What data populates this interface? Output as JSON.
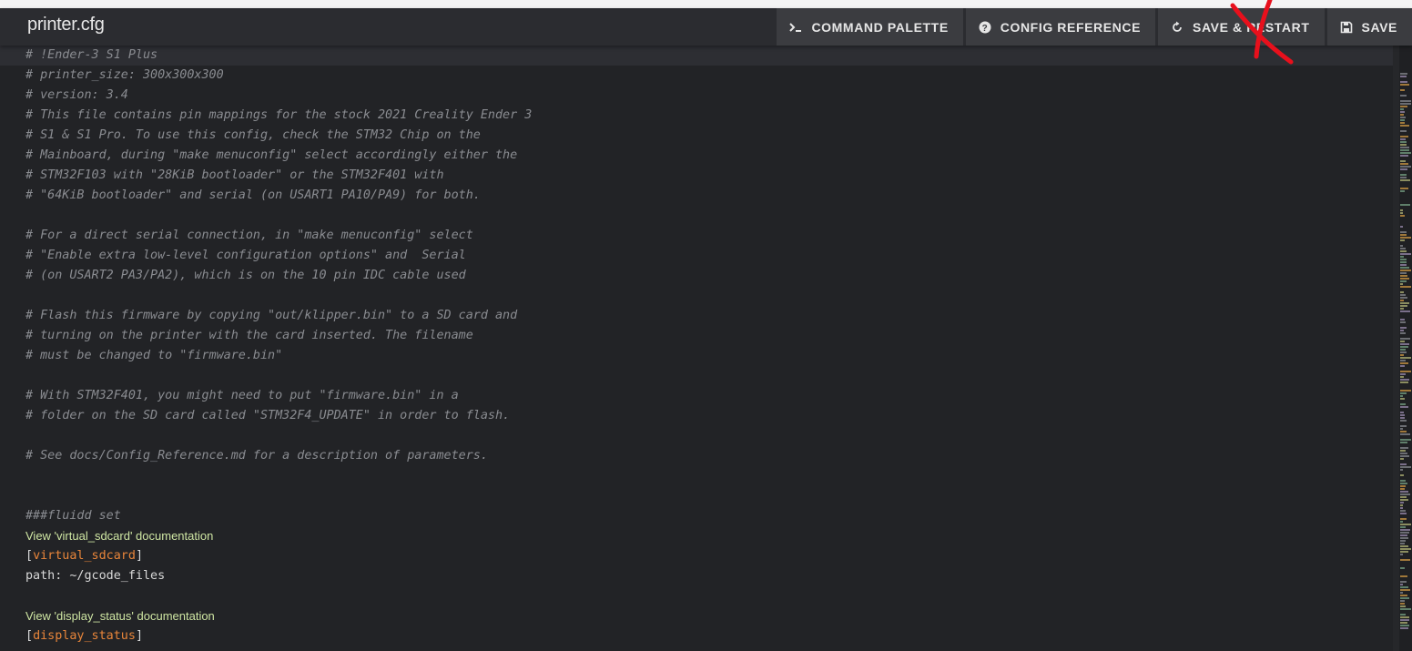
{
  "header": {
    "title": "printer.cfg",
    "buttons": [
      {
        "label": "COMMAND PALETTE",
        "icon": "terminal-icon"
      },
      {
        "label": "CONFIG REFERENCE",
        "icon": "help-circle-icon"
      },
      {
        "label": "SAVE & RESTART",
        "icon": "restart-icon"
      },
      {
        "label": "SAVE",
        "icon": "floppy-icon"
      }
    ]
  },
  "editor": {
    "lines": [
      {
        "type": "comment",
        "text": "# !Ender-3 S1 Plus"
      },
      {
        "type": "comment",
        "text": "# printer_size: 300x300x300"
      },
      {
        "type": "comment",
        "text": "# version: 3.4"
      },
      {
        "type": "comment",
        "text": "# This file contains pin mappings for the stock 2021 Creality Ender 3"
      },
      {
        "type": "comment",
        "text": "# S1 & S1 Pro. To use this config, check the STM32 Chip on the"
      },
      {
        "type": "comment",
        "text": "# Mainboard, during \"make menuconfig\" select accordingly either the"
      },
      {
        "type": "comment",
        "text": "# STM32F103 with \"28KiB bootloader\" or the STM32F401 with"
      },
      {
        "type": "comment",
        "text": "# \"64KiB bootloader\" and serial (on USART1 PA10/PA9) for both."
      },
      {
        "type": "blank",
        "text": ""
      },
      {
        "type": "comment",
        "text": "# For a direct serial connection, in \"make menuconfig\" select"
      },
      {
        "type": "comment",
        "text": "# \"Enable extra low-level configuration options\" and  Serial"
      },
      {
        "type": "comment",
        "text": "# (on USART2 PA3/PA2), which is on the 10 pin IDC cable used"
      },
      {
        "type": "blank",
        "text": ""
      },
      {
        "type": "comment",
        "text": "# Flash this firmware by copying \"out/klipper.bin\" to a SD card and"
      },
      {
        "type": "comment",
        "text": "# turning on the printer with the card inserted. The filename"
      },
      {
        "type": "comment",
        "text": "# must be changed to \"firmware.bin\""
      },
      {
        "type": "blank",
        "text": ""
      },
      {
        "type": "comment",
        "text": "# With STM32F401, you might need to put \"firmware.bin\" in a"
      },
      {
        "type": "comment",
        "text": "# folder on the SD card called \"STM32F4_UPDATE\" in order to flash."
      },
      {
        "type": "blank",
        "text": ""
      },
      {
        "type": "comment",
        "text": "# See docs/Config_Reference.md for a description of parameters."
      },
      {
        "type": "blank",
        "text": ""
      },
      {
        "type": "blank",
        "text": ""
      },
      {
        "type": "comment",
        "text": "###fluidd set"
      },
      {
        "type": "link",
        "text": "View 'virtual_sdcard' documentation"
      },
      {
        "type": "section",
        "text": "virtual_sdcard"
      },
      {
        "type": "plain",
        "text": "path: ~/gcode_files"
      },
      {
        "type": "blank",
        "text": ""
      },
      {
        "type": "link",
        "text": "View 'display_status' documentation"
      },
      {
        "type": "section",
        "text": "display_status"
      }
    ]
  },
  "colors": {
    "background": "#222326",
    "header": "#2b2c30",
    "button": "#3b3c40",
    "comment": "#8a8c91",
    "section": "#e8853a",
    "link": "#cfe6a3",
    "annotation_x": "#e8101c"
  }
}
